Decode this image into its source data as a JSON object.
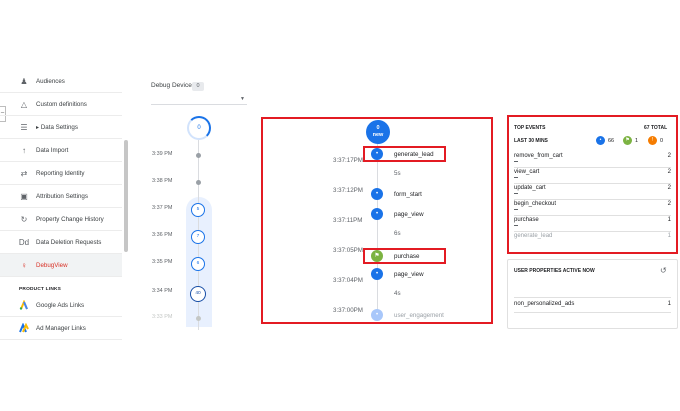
{
  "nav": {
    "items": [
      {
        "label": "Audiences",
        "icon": "audiences-icon",
        "glyph": "♟"
      },
      {
        "label": "Custom definitions",
        "icon": "custom-definitions-icon",
        "glyph": "△"
      },
      {
        "label": "▸ Data Settings",
        "icon": "database-icon",
        "glyph": "☰"
      },
      {
        "label": "Data Import",
        "icon": "upload-icon",
        "glyph": "↑"
      },
      {
        "label": "Reporting Identity",
        "icon": "reporting-identity-icon",
        "glyph": "⇄"
      },
      {
        "label": "Attribution Settings",
        "icon": "attribution-icon",
        "glyph": "▣"
      },
      {
        "label": "Property Change History",
        "icon": "history-icon",
        "glyph": "↻"
      },
      {
        "label": "Data Deletion Requests",
        "icon": "data-deletion-icon",
        "glyph": "Dd"
      },
      {
        "label": "DebugView",
        "icon": "debug-icon",
        "glyph": "♀",
        "active": true
      }
    ],
    "section_label": "PRODUCT LINKS",
    "links": [
      {
        "label": "Google Ads Links",
        "icon": "google-ads-icon"
      },
      {
        "label": "Ad Manager Links",
        "icon": "ad-manager-icon"
      }
    ],
    "edge_tab": "–"
  },
  "device": {
    "title": "Debug Device",
    "count": "0",
    "top_count": "0",
    "timeline": [
      {
        "time": "3:39 PM",
        "kind": "dot"
      },
      {
        "time": "3:38 PM",
        "kind": "dot"
      },
      {
        "time": "3:37 PM",
        "kind": "circle",
        "value": "5"
      },
      {
        "time": "3:36 PM",
        "kind": "circle",
        "value": "7"
      },
      {
        "time": "3:35 PM",
        "kind": "circle",
        "value": "6"
      },
      {
        "time": "3:34 PM",
        "kind": "circle-dark",
        "value": "40"
      },
      {
        "time": "3:33 PM",
        "kind": "dot-faint"
      }
    ]
  },
  "stream": {
    "badge_count": "0",
    "badge_label": "new",
    "events": [
      {
        "name": "generate_lead",
        "time": "3:37:17PM",
        "type": "blue",
        "highlight": true
      },
      {
        "gap": "5s"
      },
      {
        "name": "",
        "time": "3:37:12PM",
        "type": "none"
      },
      {
        "name": "form_start",
        "time": "",
        "type": "blue"
      },
      {
        "name": "page_view",
        "time": "3:37:11PM",
        "type": "blue"
      },
      {
        "gap": "6s"
      },
      {
        "name": "",
        "time": "3:37:05PM",
        "type": "none"
      },
      {
        "name": "purchase",
        "time": "",
        "type": "green",
        "highlight": true
      },
      {
        "name": "page_view",
        "time": "3:37:04PM",
        "type": "blue"
      },
      {
        "gap": "4s"
      },
      {
        "name": "",
        "time": "3:37:00PM",
        "type": "none"
      },
      {
        "name": "user_engagement",
        "time": "",
        "type": "fade"
      }
    ]
  },
  "top_events": {
    "title": "TOP EVENTS",
    "total": "67 TOTAL",
    "subtitle": "LAST 30 MINS",
    "counts": [
      {
        "icon": "event-icon",
        "value": "66",
        "color": "#1a73e8"
      },
      {
        "icon": "conversion-icon",
        "value": "1",
        "color": "#7cb342"
      },
      {
        "icon": "error-icon",
        "value": "0",
        "color": "#f57c00"
      }
    ],
    "rows": [
      {
        "name": "remove_from_cart",
        "count": "2"
      },
      {
        "name": "view_cart",
        "count": "2"
      },
      {
        "name": "update_cart",
        "count": "2"
      },
      {
        "name": "begin_checkout",
        "count": "2"
      },
      {
        "name": "purchase",
        "count": "1"
      },
      {
        "name": "generate_lead",
        "count": "1",
        "fade": true
      }
    ]
  },
  "user_properties": {
    "title": "USER PROPERTIES ACTIVE NOW",
    "rows": [
      {
        "name": "non_personalized_ads",
        "count": "1"
      }
    ]
  }
}
